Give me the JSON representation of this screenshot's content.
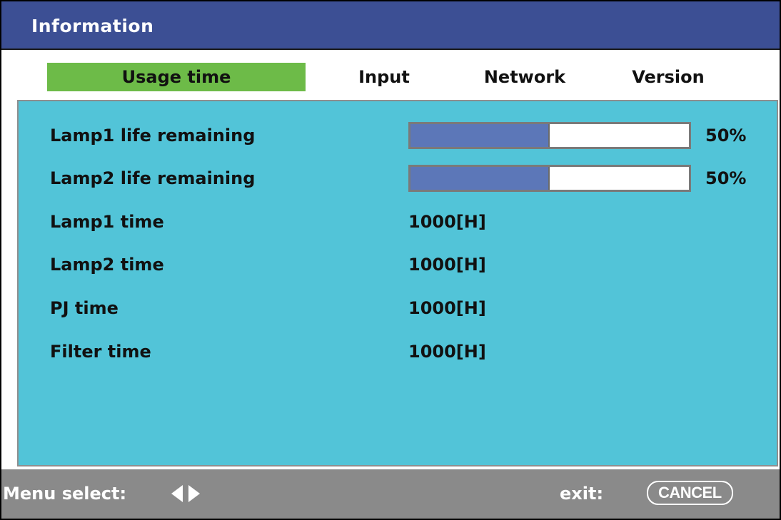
{
  "window": {
    "title": "Information"
  },
  "tabs": [
    {
      "label": "Usage time",
      "active": true
    },
    {
      "label": "Input",
      "active": false
    },
    {
      "label": "Network",
      "active": false
    },
    {
      "label": "Version",
      "active": false
    }
  ],
  "usage": {
    "lamp1_life": {
      "label": "Lamp1 life remaining",
      "percent_text": "50%",
      "fill_fraction": 0.5
    },
    "lamp2_life": {
      "label": "Lamp2 life remaining",
      "percent_text": "50%",
      "fill_fraction": 0.5
    },
    "lamp1_time": {
      "label": "Lamp1 time",
      "value": "1000[H]"
    },
    "lamp2_time": {
      "label": "Lamp2 time",
      "value": "1000[H]"
    },
    "pj_time": {
      "label": "PJ time",
      "value": "1000[H]"
    },
    "filter_time": {
      "label": "Filter time",
      "value": "1000[H]"
    }
  },
  "footer": {
    "menu_select_label": "Menu select:",
    "menu_select_icon": "left-right-arrows-icon",
    "exit_label": "exit:",
    "cancel_key": "CANCEL"
  },
  "colors": {
    "title_bar": "#3c4f94",
    "active_tab": "#6dbb48",
    "panel": "#52c4d8",
    "bar_fill": "#5c77b8",
    "footer": "#8a8a8a"
  }
}
